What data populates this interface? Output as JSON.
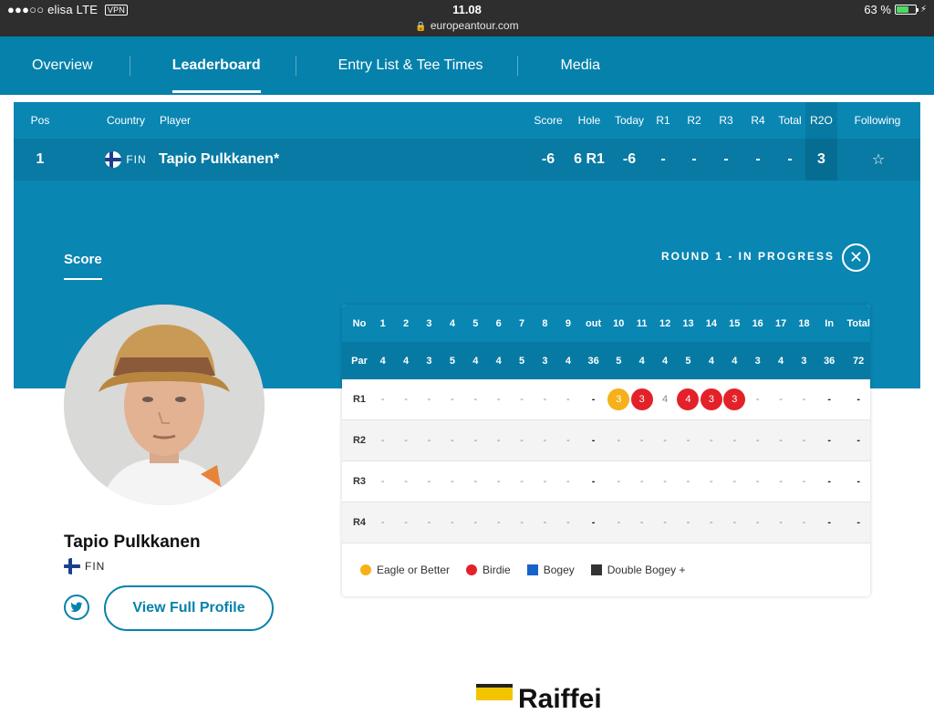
{
  "status_bar": {
    "carrier": "●●●○○ elisa  LTE",
    "vpn": "VPN",
    "time": "11.08",
    "url": "europeantour.com",
    "battery": "63 %",
    "battery_level": 0.63
  },
  "nav": {
    "items": [
      "Overview",
      "Leaderboard",
      "Entry List & Tee Times",
      "Media"
    ],
    "active": "Leaderboard"
  },
  "leaderboard": {
    "headers": {
      "pos": "Pos",
      "country": "Country",
      "player": "Player",
      "score": "Score",
      "hole": "Hole",
      "today": "Today",
      "r1": "R1",
      "r2": "R2",
      "r3": "R3",
      "r4": "R4",
      "total": "Total",
      "r2o": "R2O",
      "following": "Following"
    },
    "row": {
      "pos": "1",
      "country": "FIN",
      "player": "Tapio Pulkkanen*",
      "score": "-6",
      "hole": "6 R1",
      "today": "-6",
      "r1": "-",
      "r2": "-",
      "r3": "-",
      "r4": "-",
      "total": "-",
      "r2o": "3",
      "following_icon": "star-outline-icon"
    }
  },
  "panel": {
    "tab": "Score",
    "round_status": "ROUND 1 - IN PROGRESS",
    "close_icon": "close-icon"
  },
  "player": {
    "name": "Tapio Pulkkanen",
    "country": "FIN",
    "twitter_icon": "twitter-icon",
    "profile_button": "View Full Profile"
  },
  "scorecard": {
    "header_label": "No",
    "holes": [
      "1",
      "2",
      "3",
      "4",
      "5",
      "6",
      "7",
      "8",
      "9",
      "out",
      "10",
      "11",
      "12",
      "13",
      "14",
      "15",
      "16",
      "17",
      "18",
      "In",
      "Total"
    ],
    "par_label": "Par",
    "par": [
      "4",
      "4",
      "3",
      "5",
      "4",
      "4",
      "5",
      "3",
      "4",
      "36",
      "5",
      "4",
      "4",
      "5",
      "4",
      "4",
      "3",
      "4",
      "3",
      "36",
      "72"
    ],
    "rounds": [
      {
        "label": "R1",
        "scores": [
          "-",
          "-",
          "-",
          "-",
          "-",
          "-",
          "-",
          "-",
          "-",
          "-",
          "3",
          "3",
          "4",
          "4",
          "3",
          "3",
          "-",
          "-",
          "-",
          "-",
          "-"
        ],
        "marks": [
          "",
          "",
          "",
          "",
          "",
          "",
          "",
          "",
          "",
          "",
          "eagle",
          "birdie",
          "",
          "birdie",
          "birdie",
          "birdie",
          "",
          "",
          "",
          "",
          ""
        ]
      },
      {
        "label": "R2",
        "scores": [
          "-",
          "-",
          "-",
          "-",
          "-",
          "-",
          "-",
          "-",
          "-",
          "-",
          "-",
          "-",
          "-",
          "-",
          "-",
          "-",
          "-",
          "-",
          "-",
          "-",
          "-"
        ]
      },
      {
        "label": "R3",
        "scores": [
          "-",
          "-",
          "-",
          "-",
          "-",
          "-",
          "-",
          "-",
          "-",
          "-",
          "-",
          "-",
          "-",
          "-",
          "-",
          "-",
          "-",
          "-",
          "-",
          "-",
          "-"
        ]
      },
      {
        "label": "R4",
        "scores": [
          "-",
          "-",
          "-",
          "-",
          "-",
          "-",
          "-",
          "-",
          "-",
          "-",
          "-",
          "-",
          "-",
          "-",
          "-",
          "-",
          "-",
          "-",
          "-",
          "-",
          "-"
        ]
      }
    ],
    "legend": [
      {
        "label": "Eagle or Better",
        "color": "#f5b01a",
        "shape": "circle"
      },
      {
        "label": "Birdie",
        "color": "#e32129",
        "shape": "circle"
      },
      {
        "label": "Bogey",
        "color": "#1763c9",
        "shape": "square"
      },
      {
        "label": "Double Bogey +",
        "color": "#333333",
        "shape": "square"
      }
    ]
  },
  "sponsor": {
    "text": "Raiffei"
  },
  "colors": {
    "primary": "#0581ab",
    "eagle": "#f5b01a",
    "birdie": "#e32129"
  }
}
